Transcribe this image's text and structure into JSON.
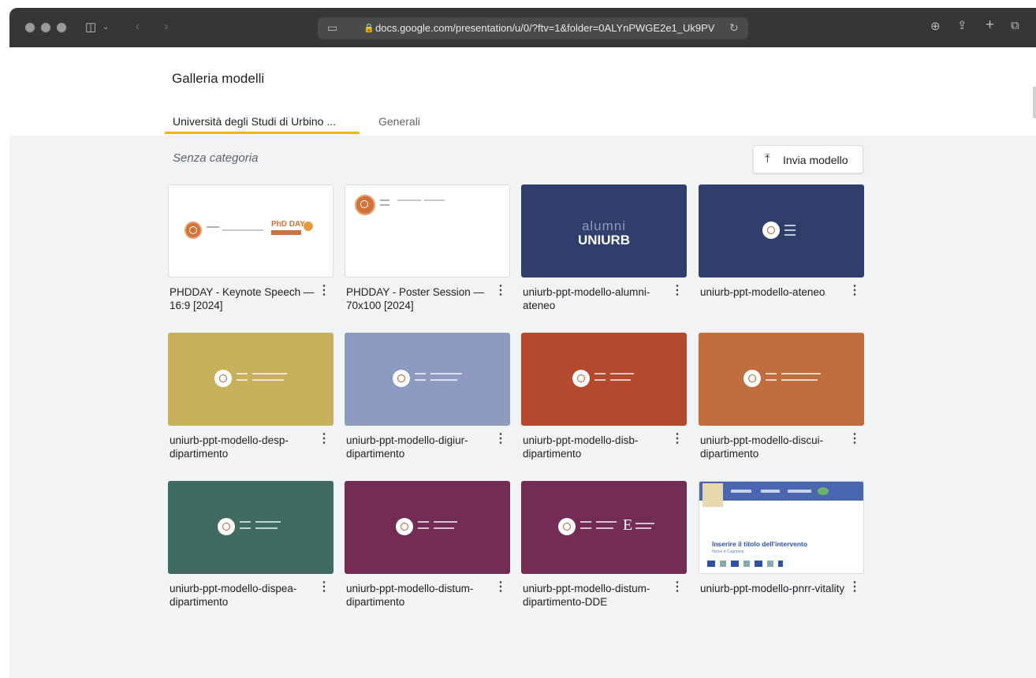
{
  "browser": {
    "url": "docs.google.com/presentation/u/0/?ftv=1&folder=0ALYnPWGE2e1_Uk9PV"
  },
  "page": {
    "title": "Galleria modelli",
    "tabs": [
      {
        "label": "Università degli Studi di Urbino ..."
      },
      {
        "label": "Generali"
      }
    ],
    "section_label": "Senza categoria",
    "submit_label": "Invia modello"
  },
  "templates": [
    {
      "name": "PHDDAY - Keynote Speech — 16:9 [2024]",
      "thumb_color": "#ffffff",
      "badge": "PhD DAY"
    },
    {
      "name": "PHDDAY - Poster Session — 70x100 [2024]",
      "thumb_color": "#ffffff"
    },
    {
      "name": "uniurb-ppt-modello-alumni-ateneo",
      "thumb_color": "#2f3e6b",
      "brand_top": "alumni",
      "brand_bottom": "UNIURB"
    },
    {
      "name": "uniurb-ppt-modello-ateneo",
      "thumb_color": "#2f3e6b"
    },
    {
      "name": "uniurb-ppt-modello-desp-dipartimento",
      "thumb_color": "#c8b15c"
    },
    {
      "name": "uniurb-ppt-modello-digiur-dipartimento",
      "thumb_color": "#8e9bc1"
    },
    {
      "name": "uniurb-ppt-modello-disb-dipartimento",
      "thumb_color": "#b4492d"
    },
    {
      "name": "uniurb-ppt-modello-discui-dipartimento",
      "thumb_color": "#c06e3e"
    },
    {
      "name": "uniurb-ppt-modello-dispea-dipartimento",
      "thumb_color": "#3f6b60"
    },
    {
      "name": "uniurb-ppt-modello-distum-dipartimento",
      "thumb_color": "#722c55"
    },
    {
      "name": "uniurb-ppt-modello-distum-dipartimento-DDE",
      "thumb_color": "#722c55",
      "mark": "E"
    },
    {
      "name": "uniurb-ppt-modello-pnrr-vitality",
      "thumb_color": "#ffffff",
      "slide_title": "Inserire il titolo dell'intervento",
      "slide_subtitle": "Nome e Cognome"
    }
  ]
}
